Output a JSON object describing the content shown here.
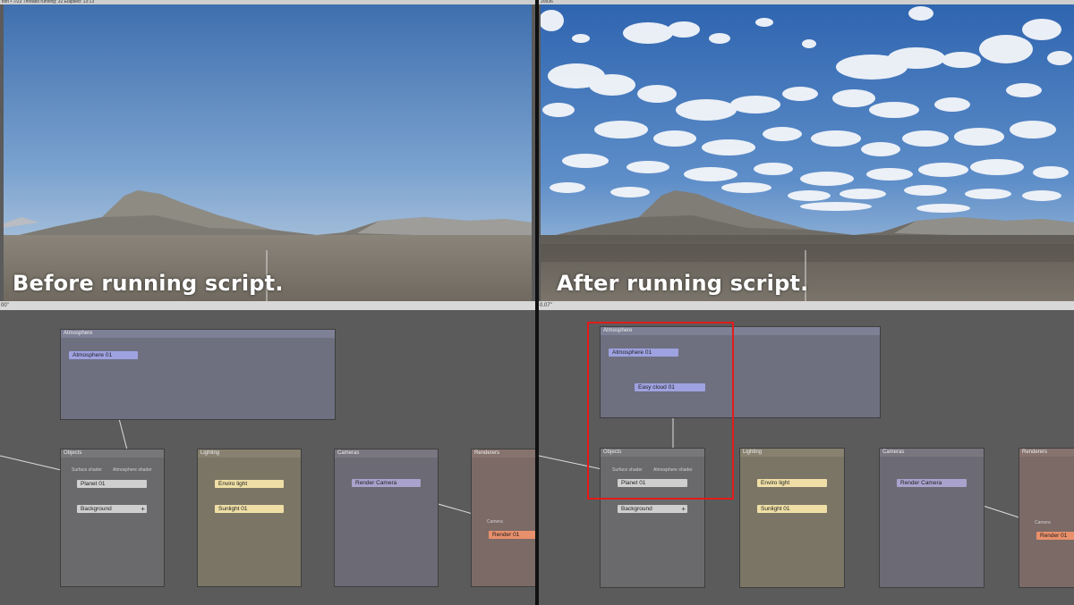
{
  "left": {
    "status": "tion • 7/23    Threads running: 32    Elapsed: 13:13",
    "caption": "Before running script.",
    "timeline": "00\"",
    "groups": {
      "atmosphere": "Atmosphere",
      "objects": "Objects",
      "lighting": "Lighting",
      "cameras": "Cameras",
      "renderers": "Renderers"
    },
    "nodes": {
      "atmosphere": "Atmosphere 01",
      "planet": "Planet 01",
      "background": "Background",
      "enviro": "Enviro light",
      "sunlight": "Sunlight 01",
      "camera": "Render Camera",
      "render": "Render 01"
    },
    "ports": {
      "surface_shader": "Surface shader",
      "atmosphere_shader": "Atmosphere shader",
      "camera": "Camera"
    }
  },
  "right": {
    "status": "20936",
    "caption": "After running script.",
    "timeline": "0.07\"",
    "groups": {
      "atmosphere": "Atmosphere",
      "objects": "Objects",
      "lighting": "Lighting",
      "cameras": "Cameras",
      "renderers": "Renderers"
    },
    "nodes": {
      "atmosphere": "Atmosphere 01",
      "cloud": "Easy cloud 01",
      "planet": "Planet 01",
      "background": "Background",
      "enviro": "Enviro light",
      "sunlight": "Sunlight 01",
      "camera": "Render Camera",
      "render": "Render 01"
    },
    "ports": {
      "surface_shader": "Surface shader",
      "atmosphere_shader": "Atmosphere shader",
      "camera": "Camera"
    }
  },
  "colors": {
    "highlight": "#e21b1b",
    "atmosphere_node": "#9ea2e0",
    "object_node": "#cfcfcf",
    "light_node": "#efdfa6",
    "camera_node": "#a9a2cc",
    "render_node": "#e8906b"
  }
}
